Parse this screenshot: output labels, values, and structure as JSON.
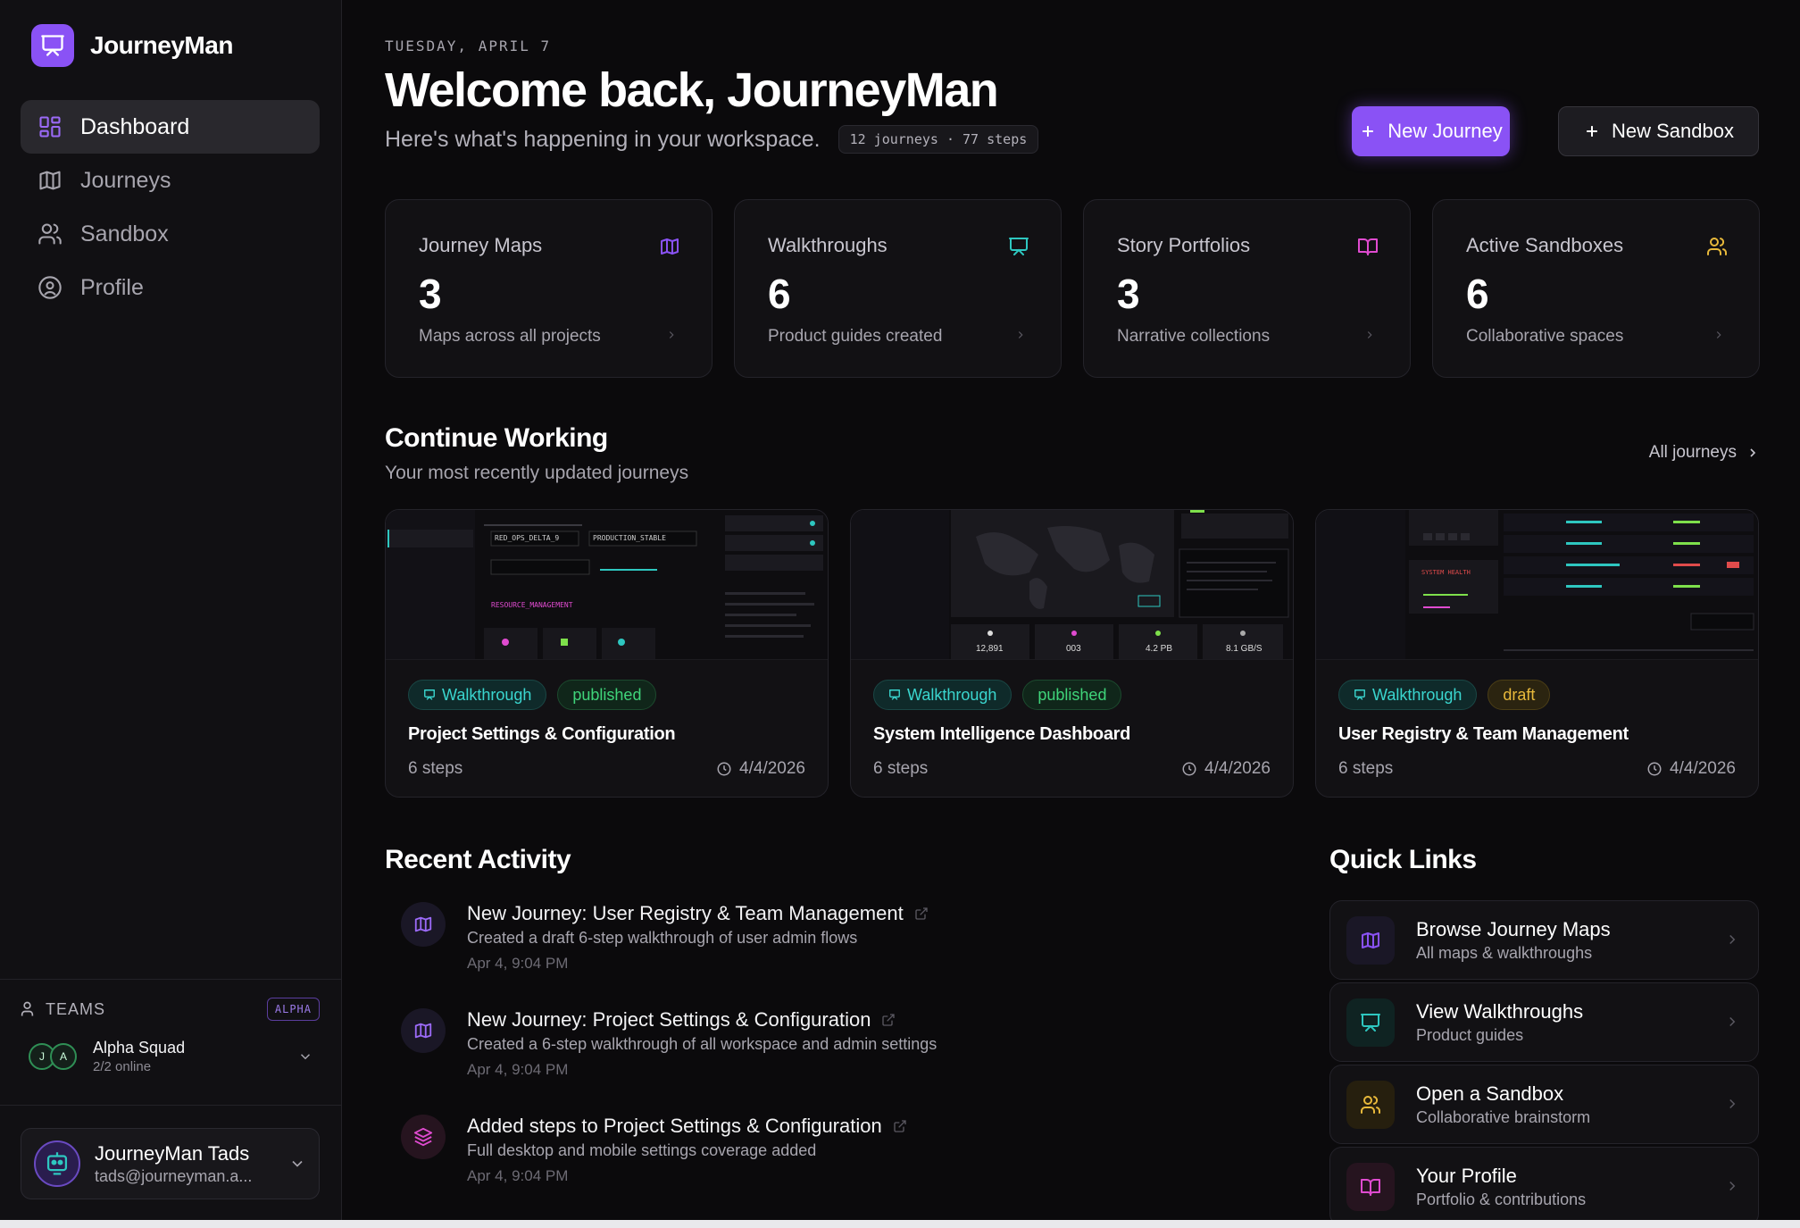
{
  "brand": {
    "name": "JourneyMan"
  },
  "nav": [
    {
      "label": "Dashboard",
      "icon": "grid-icon",
      "active": true
    },
    {
      "label": "Journeys",
      "icon": "map-icon"
    },
    {
      "label": "Sandbox",
      "icon": "users-icon"
    },
    {
      "label": "Profile",
      "icon": "user-circle-icon"
    }
  ],
  "teams": {
    "label": "TEAMS",
    "badge": "ALPHA",
    "team_name": "Alpha Squad",
    "online": "2/2 online",
    "avatars": [
      "J",
      "A"
    ]
  },
  "user": {
    "name": "JourneyMan Tads",
    "email": "tads@journeyman.a..."
  },
  "header": {
    "date": "TUESDAY, APRIL 7",
    "title": "Welcome back, JourneyMan",
    "subtitle": "Here's what's happening in your workspace.",
    "counts": "12 journeys · 77 steps",
    "new_journey": "New Journey",
    "new_sandbox": "New Sandbox"
  },
  "stats": [
    {
      "label": "Journey Maps",
      "value": "3",
      "desc": "Maps across all projects",
      "icon": "map-icon",
      "color": "#8a52f5"
    },
    {
      "label": "Walkthroughs",
      "value": "6",
      "desc": "Product guides created",
      "icon": "presentation-icon",
      "color": "#2ec7c0"
    },
    {
      "label": "Story Portfolios",
      "value": "3",
      "desc": "Narrative collections",
      "icon": "book-icon",
      "color": "#e04bd0"
    },
    {
      "label": "Active Sandboxes",
      "value": "6",
      "desc": "Collaborative spaces",
      "icon": "users-icon",
      "color": "#e8b93b"
    }
  ],
  "continue": {
    "title": "Continue Working",
    "subtitle": "Your most recently updated journeys",
    "all_link": "All journeys",
    "cards": [
      {
        "type": "Walkthrough",
        "status": "published",
        "title": "Project Settings & Configuration",
        "steps": "6 steps",
        "date": "4/4/2026",
        "thumb": {
          "field_1": "RED_OPS_DELTA_9",
          "field_2": "PRODUCTION_STABLE",
          "section": "RESOURCE_MANAGEMENT"
        }
      },
      {
        "type": "Walkthrough",
        "status": "published",
        "title": "System Intelligence Dashboard",
        "steps": "6 steps",
        "date": "4/4/2026",
        "thumb": {
          "metrics": [
            "12,891",
            "003",
            "4.2 PB",
            "8.1 GB/S"
          ]
        }
      },
      {
        "type": "Walkthrough",
        "status": "draft",
        "title": "User Registry & Team Management",
        "steps": "6 steps",
        "date": "4/4/2026",
        "thumb": {
          "label": "SYSTEM HEALTH"
        }
      }
    ]
  },
  "activity": {
    "title": "Recent Activity",
    "items": [
      {
        "title": "New Journey: User Registry & Team Management",
        "desc": "Created a draft 6-step walkthrough of user admin flows",
        "time": "Apr 4, 9:04 PM",
        "icon": "map-icon"
      },
      {
        "title": "New Journey: Project Settings & Configuration",
        "desc": "Created a 6-step walkthrough of all workspace and admin settings",
        "time": "Apr 4, 9:04 PM",
        "icon": "map-icon"
      },
      {
        "title": "Added steps to Project Settings & Configuration",
        "desc": "Full desktop and mobile settings coverage added",
        "time": "Apr 4, 9:04 PM",
        "icon": "layers-icon"
      }
    ]
  },
  "quick_links": {
    "title": "Quick Links",
    "items": [
      {
        "title": "Browse Journey Maps",
        "sub": "All maps & walkthroughs",
        "icon": "map-icon",
        "color": "#8a52f5"
      },
      {
        "title": "View Walkthroughs",
        "sub": "Product guides",
        "icon": "presentation-icon",
        "color": "#2ec7c0"
      },
      {
        "title": "Open a Sandbox",
        "sub": "Collaborative brainstorm",
        "icon": "users-icon",
        "color": "#e8b93b"
      },
      {
        "title": "Your Profile",
        "sub": "Portfolio & contributions",
        "icon": "book-icon",
        "color": "#e04bd0"
      }
    ]
  }
}
